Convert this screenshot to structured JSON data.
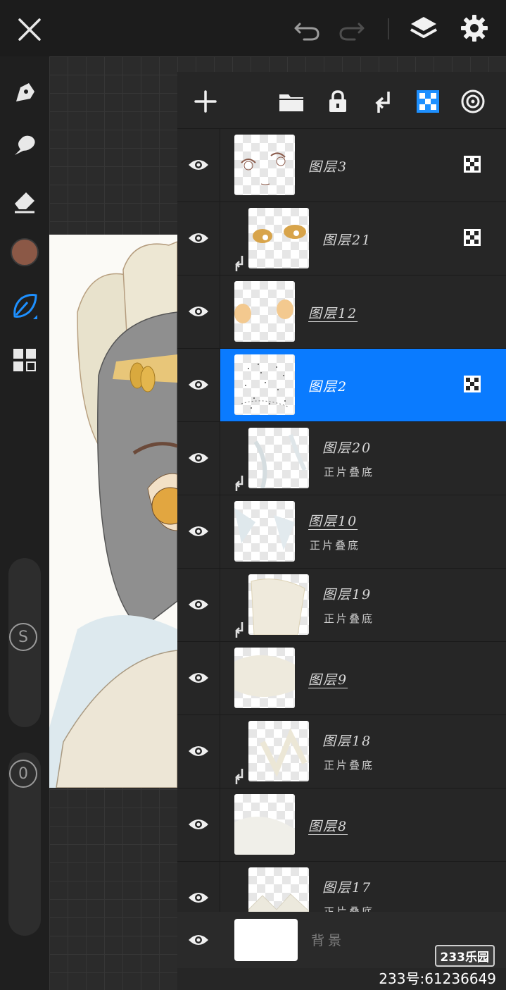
{
  "toolbar": {
    "close_icon": "close-icon",
    "undo_icon": "undo-icon",
    "redo_icon": "redo-icon",
    "layers_icon": "layers-icon",
    "settings_icon": "gear-icon"
  },
  "tools": {
    "items": [
      "pen-tool",
      "smudge-tool",
      "eraser-tool",
      "color-swatch",
      "brush-tool",
      "gallery-tool"
    ],
    "current_color": "#8b5846",
    "accent": "#1e90ff"
  },
  "sliders": {
    "size_label": "S",
    "opacity_label": "0"
  },
  "layers_panel": {
    "actions": [
      "add-layer",
      "folder",
      "lock",
      "clip-mask",
      "alpha-lock",
      "blend"
    ],
    "layers": [
      {
        "name": "图层3",
        "mode": "",
        "clipped": false,
        "selected": false,
        "alpha_locked": true,
        "underline": false
      },
      {
        "name": "图层21",
        "mode": "",
        "clipped": true,
        "selected": false,
        "alpha_locked": true,
        "underline": false
      },
      {
        "name": "图层12",
        "mode": "",
        "clipped": false,
        "selected": false,
        "alpha_locked": false,
        "underline": true
      },
      {
        "name": "图层2",
        "mode": "",
        "clipped": false,
        "selected": true,
        "alpha_locked": true,
        "underline": false
      },
      {
        "name": "图层20",
        "mode": "正片叠底",
        "clipped": true,
        "selected": false,
        "alpha_locked": false,
        "underline": false
      },
      {
        "name": "图层10",
        "mode": "正片叠底",
        "clipped": false,
        "selected": false,
        "alpha_locked": false,
        "underline": true
      },
      {
        "name": "图层19",
        "mode": "正片叠底",
        "clipped": true,
        "selected": false,
        "alpha_locked": false,
        "underline": false
      },
      {
        "name": "图层9",
        "mode": "",
        "clipped": false,
        "selected": false,
        "alpha_locked": false,
        "underline": true
      },
      {
        "name": "图层18",
        "mode": "正片叠底",
        "clipped": true,
        "selected": false,
        "alpha_locked": false,
        "underline": false
      },
      {
        "name": "图层8",
        "mode": "",
        "clipped": false,
        "selected": false,
        "alpha_locked": false,
        "underline": true
      },
      {
        "name": "图层17",
        "mode": "正片叠底",
        "clipped": true,
        "selected": false,
        "alpha_locked": false,
        "underline": false
      }
    ],
    "background_label": "背景"
  },
  "watermark": {
    "badge": "233乐园",
    "id_text": "233号:61236649"
  }
}
